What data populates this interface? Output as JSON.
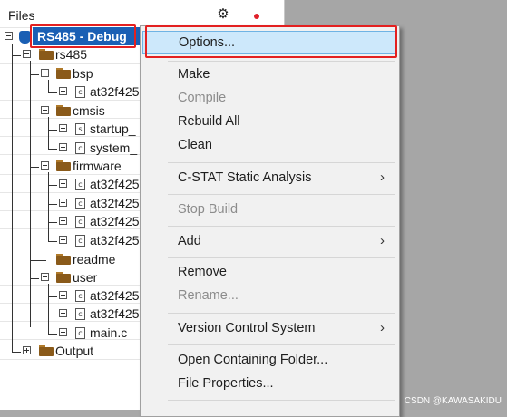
{
  "panel": {
    "title": "Files",
    "gear_icon": "gear-icon",
    "dot_color": "#e0202a"
  },
  "tree": {
    "root": "RS485 - Debug",
    "rs485": "rs485",
    "bsp": "bsp",
    "bsp_file": "at32f425",
    "cmsis": "cmsis",
    "startup": "startup_",
    "system": "system_",
    "firmware": "firmware",
    "fw1": "at32f425",
    "fw2": "at32f425",
    "fw3": "at32f425",
    "fw4": "at32f425",
    "readme": "readme",
    "user": "user",
    "user1": "at32f425",
    "user2": "at32f425",
    "main": "main.c",
    "output": "Output",
    "file_glyph_c": "c",
    "file_glyph_s": "s"
  },
  "menu": {
    "options": "Options...",
    "make": "Make",
    "compile": "Compile",
    "rebuild_all": "Rebuild All",
    "clean": "Clean",
    "cstat": "C-STAT Static Analysis",
    "stop_build": "Stop Build",
    "add": "Add",
    "remove": "Remove",
    "rename": "Rename...",
    "vcs": "Version Control System",
    "open_folder": "Open Containing Folder...",
    "file_props": "File Properties...",
    "submenu_arrow": "›"
  },
  "watermark": "CSDN @KAWASAKIDU",
  "colors": {
    "selection": "#1a5fb4",
    "highlight_box": "#e32020",
    "menu_hover": "#cde8fb"
  }
}
